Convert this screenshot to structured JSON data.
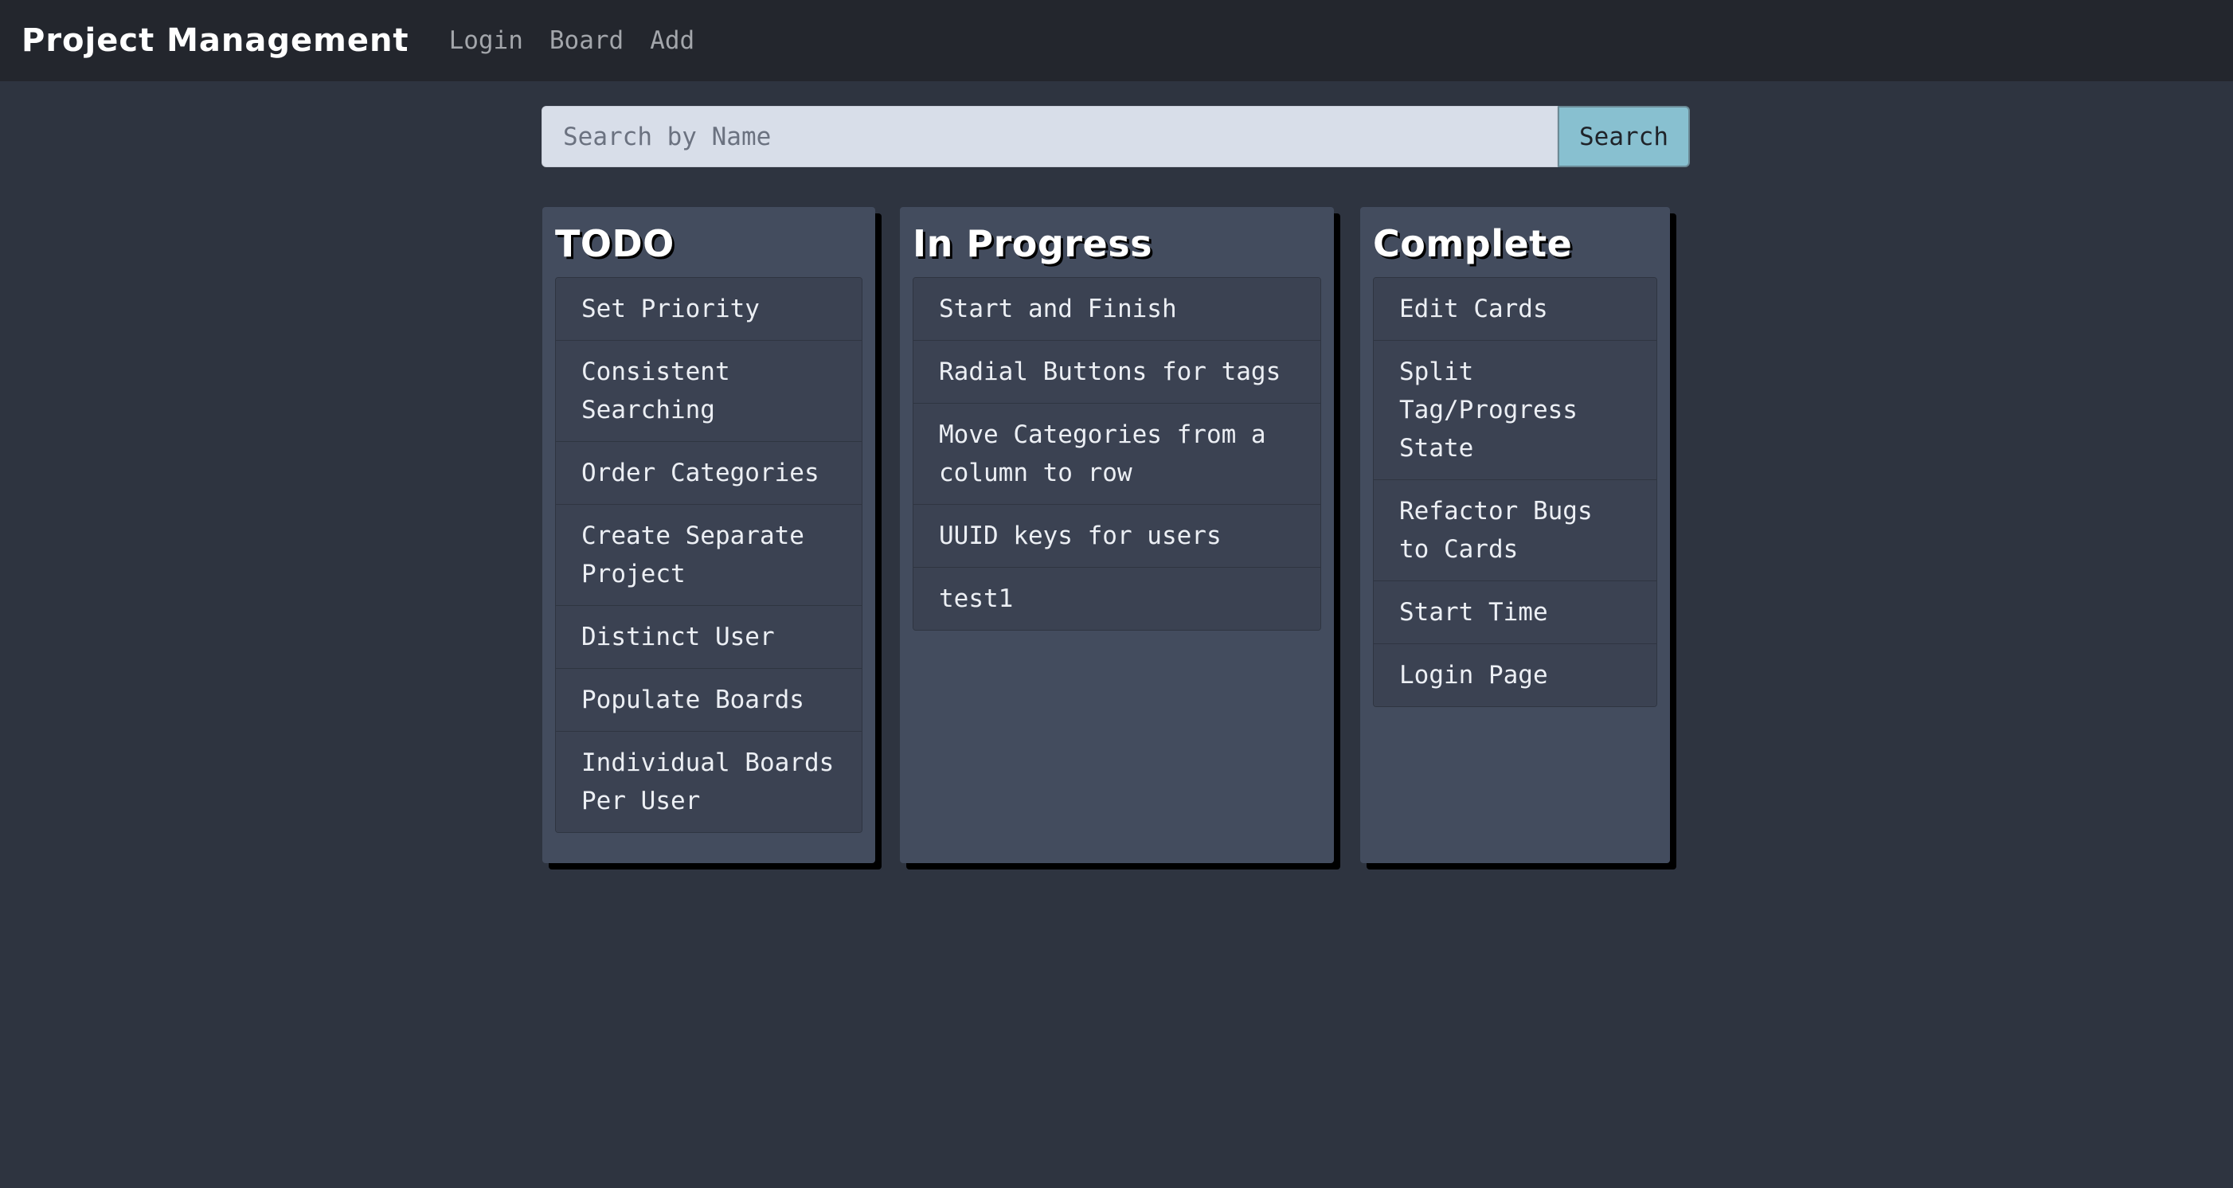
{
  "navbar": {
    "brand": "Project Management",
    "links": [
      "Login",
      "Board",
      "Add"
    ]
  },
  "search": {
    "placeholder": "Search by Name",
    "value": "",
    "button_label": "Search"
  },
  "columns": [
    {
      "title": "TODO",
      "cards": [
        "Set Priority",
        "Consistent Searching",
        "Order Categories",
        "Create Separate Project",
        "Distinct User",
        "Populate Boards",
        "Individual Boards Per User"
      ]
    },
    {
      "title": "In Progress",
      "cards": [
        "Start and Finish",
        "Radial Buttons for tags",
        "Move Categories from a column to row",
        "UUID keys for users",
        "test1"
      ]
    },
    {
      "title": "Complete",
      "cards": [
        "Edit Cards",
        "Split Tag/Progress State",
        "Refactor Bugs to Cards",
        "Start Time",
        "Login Page"
      ]
    }
  ],
  "colors": {
    "page_background": "#2e3440",
    "navbar_background": "#23262d",
    "column_background": "#434c5e",
    "card_background": "#3b4252",
    "search_button": "#88c0d0"
  }
}
